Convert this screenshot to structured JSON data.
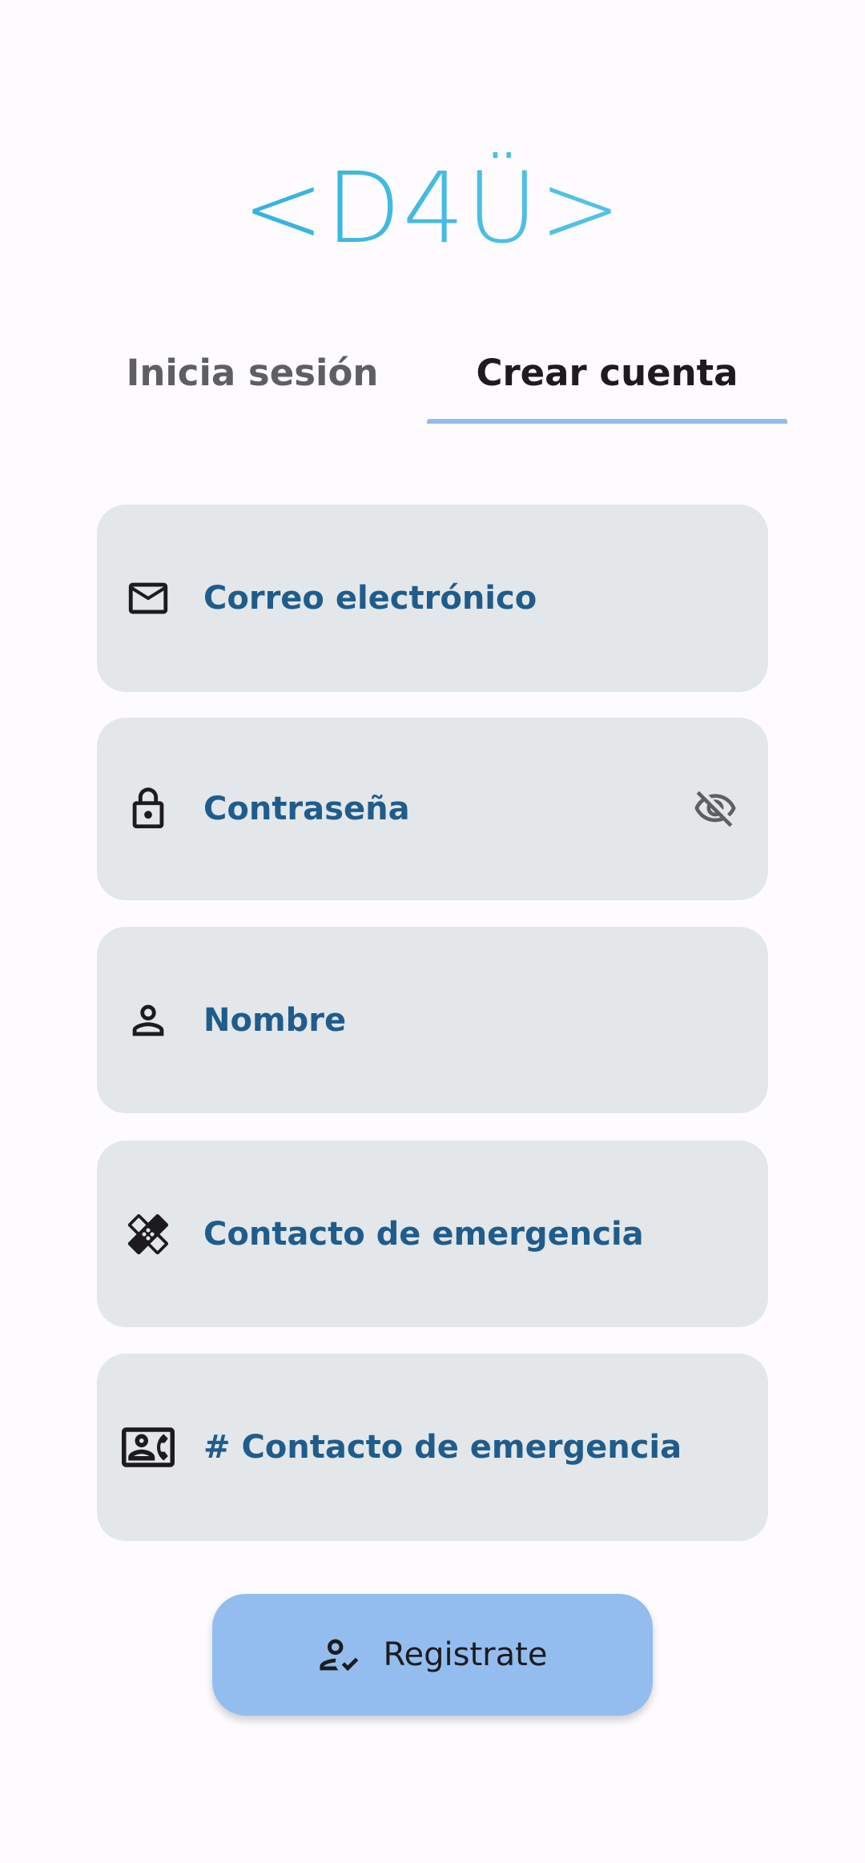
{
  "logo": {
    "text": "<D4Ü>"
  },
  "tabs": [
    {
      "label": "Inicia sesión",
      "selected": false
    },
    {
      "label": "Crear cuenta",
      "selected": true
    }
  ],
  "form": {
    "fields": [
      {
        "placeholder": "Correo electrónico",
        "icon": "mail-icon"
      },
      {
        "placeholder": "Contraseña",
        "icon": "lock-icon",
        "trailing_icon": "visibility-off-icon"
      },
      {
        "placeholder": "Nombre",
        "icon": "person-icon"
      },
      {
        "placeholder": "Contacto de emergencia",
        "icon": "healing-icon"
      },
      {
        "placeholder": "# Contacto de emergencia",
        "icon": "contact-phone-icon"
      }
    ],
    "submit_label": "Registrate",
    "submit_icon": "how-to-reg-icon"
  },
  "colors": {
    "background": "#fefbfe",
    "field_background": "#e3e7e9",
    "field_label": "#1f5c8c",
    "tab_indicator": "#93bde9",
    "button_background": "#93bdee",
    "logo_accent": "#1ba6dd"
  }
}
